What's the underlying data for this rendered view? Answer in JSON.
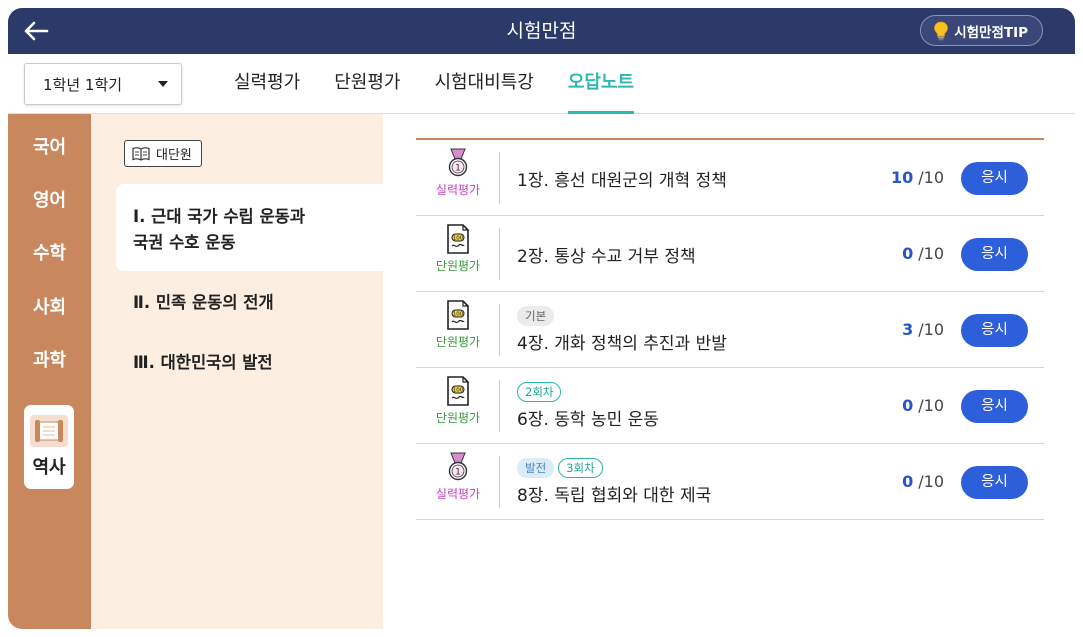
{
  "header": {
    "title": "시험만점",
    "tip_label": "시험만점TIP"
  },
  "semester": {
    "selected": "1학년 1학기"
  },
  "tabs": [
    {
      "label": "실력평가",
      "active": false
    },
    {
      "label": "단원평가",
      "active": false
    },
    {
      "label": "시험대비특강",
      "active": false
    },
    {
      "label": "오답노트",
      "active": true
    }
  ],
  "subjects": [
    {
      "label": "국어",
      "active": false
    },
    {
      "label": "영어",
      "active": false
    },
    {
      "label": "수학",
      "active": false
    },
    {
      "label": "사회",
      "active": false
    },
    {
      "label": "과학",
      "active": false
    },
    {
      "label": "역사",
      "active": true
    }
  ],
  "units": {
    "badge_label": "대단원",
    "items": [
      {
        "line1": "Ⅰ. 근대 국가 수립 운동과",
        "line2": "국권 수호 운동",
        "active": true
      },
      {
        "line1": "Ⅱ. 민족 운동의 전개",
        "line2": "",
        "active": false
      },
      {
        "line1": "Ⅲ. 대한민국의 발전",
        "line2": "",
        "active": false
      }
    ]
  },
  "rows": [
    {
      "type": "실력평가",
      "kind": "skill",
      "chips": [],
      "title": "1장. 흥선 대원군의 개혁 정책",
      "score": "10",
      "total": "/10",
      "button": "응시"
    },
    {
      "type": "단원평가",
      "kind": "unit",
      "chips": [],
      "title": "2장. 통상 수교 거부 정책",
      "score": "0",
      "total": "/10",
      "button": "응시"
    },
    {
      "type": "단원평가",
      "kind": "unit",
      "chips": [
        {
          "text": "기본",
          "style": "basic"
        }
      ],
      "title": "4장. 개화 정책의 추진과 반발",
      "score": "3",
      "total": "/10",
      "button": "응시"
    },
    {
      "type": "단원평가",
      "kind": "unit",
      "chips": [
        {
          "text": "2회차",
          "style": "round"
        }
      ],
      "title": "6장. 동학 농민 운동",
      "score": "0",
      "total": "/10",
      "button": "응시"
    },
    {
      "type": "실력평가",
      "kind": "skill",
      "chips": [
        {
          "text": "발전",
          "style": "adv"
        },
        {
          "text": "3회차",
          "style": "round"
        }
      ],
      "title": "8장. 독립 협회와 대한 제국",
      "score": "0",
      "total": "/10",
      "button": "응시"
    }
  ],
  "colors": {
    "header_bg": "#2c3a69",
    "accent_teal": "#2eb8b4",
    "sidebar_brown": "#c8875d",
    "unit_panel_bg": "#fcefe2",
    "button_blue": "#2e5fdb",
    "score_blue": "#2356c6",
    "skill_magenta": "#c845c4",
    "unit_green": "#3a9a3a"
  }
}
